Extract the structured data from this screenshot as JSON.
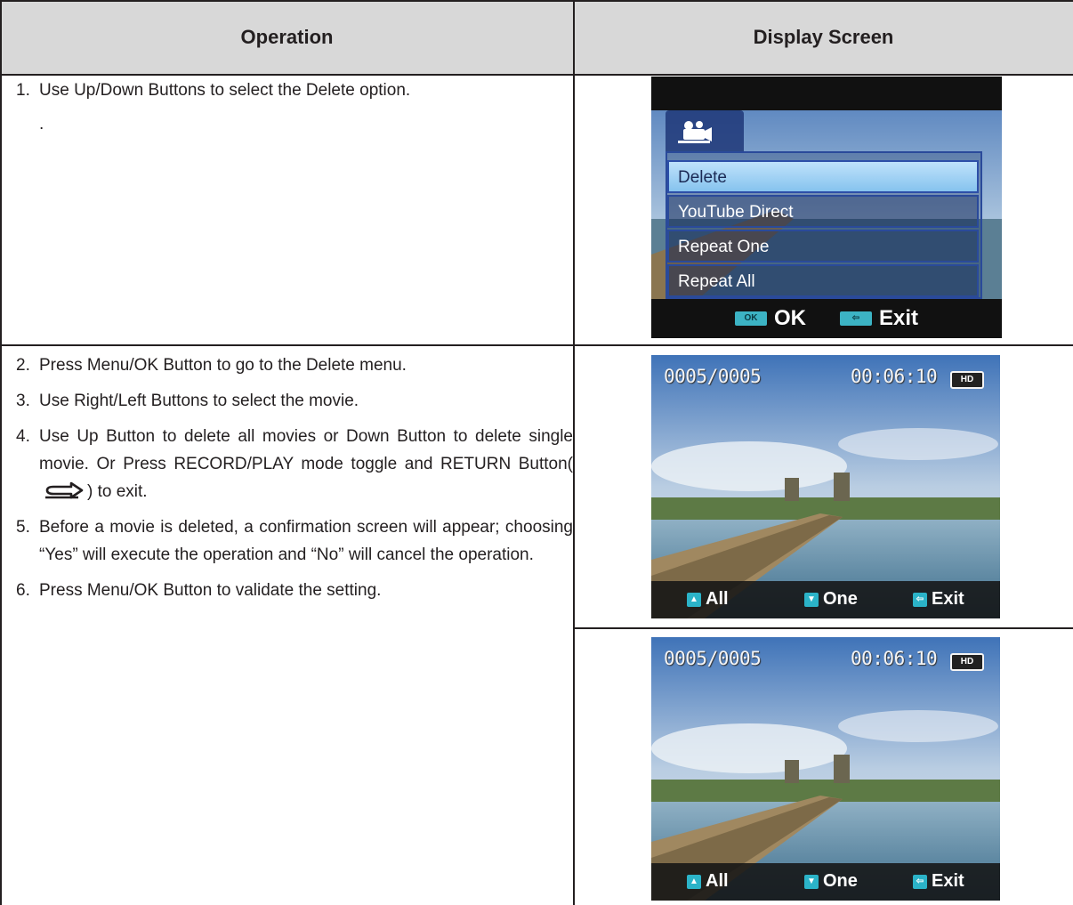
{
  "table": {
    "headers": [
      "Operation",
      "Display Screen"
    ]
  },
  "steps_row1": [
    {
      "num": "1.",
      "text": "Use Up/Down Buttons to select the Delete option."
    },
    {
      "num": "",
      "text": "."
    }
  ],
  "steps_row2": [
    {
      "num": "2.",
      "text": "Press Menu/OK Button to go to the Delete menu."
    },
    {
      "num": "3.",
      "text": "Use Right/Left Buttons to select the movie."
    },
    {
      "num": "4.",
      "text_before": "Use Up Button to delete all movies or Down Button to delete single movie. Or Press RECORD/PLAY mode toggle and RETURN Button(",
      "text_after": ") to exit."
    },
    {
      "num": "5.",
      "text": "Before a movie is deleted, a confirmation screen will appear; choosing “Yes” will execute the operation and “No” will cancel the operation."
    },
    {
      "num": "6.",
      "text": "Press Menu/OK Button to validate the setting."
    }
  ],
  "menu_screen": {
    "tab_icon": "movie-camera-icon",
    "items": [
      "Delete",
      "YouTube Direct",
      "Repeat One",
      "Repeat  All"
    ],
    "selected_index": 0,
    "footer": {
      "ok_label": "OK",
      "exit_label": "Exit"
    }
  },
  "playback_screens": [
    {
      "counter": "0005/0005",
      "time": "00:06:10",
      "badge": "HD",
      "keys": [
        "All",
        "One",
        "Exit"
      ]
    },
    {
      "counter": "0005/0005",
      "time": "00:06:10",
      "badge": "HD",
      "keys": [
        "All",
        "One",
        "Exit"
      ]
    }
  ],
  "colors": {
    "header_bg": "#d8d8d8",
    "menu_highlight": "#9fd0f3",
    "key_accent": "#2bb3c8"
  }
}
